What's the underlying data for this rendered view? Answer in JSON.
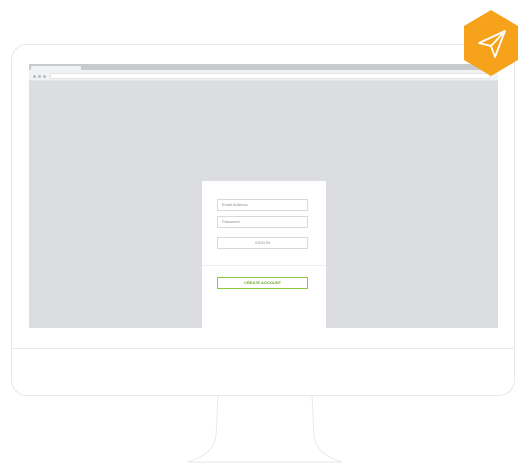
{
  "login_form": {
    "email_placeholder": "Email Address",
    "password_placeholder": "Password",
    "sign_in_label": "SIGN IN",
    "create_account_label": "CREATE ACCOUNT"
  },
  "badge": {
    "icon": "paper-plane-icon",
    "color": "#f6a21a"
  },
  "colors": {
    "screen_bg": "#dcdde0",
    "accent_green": "#8cc63f"
  }
}
